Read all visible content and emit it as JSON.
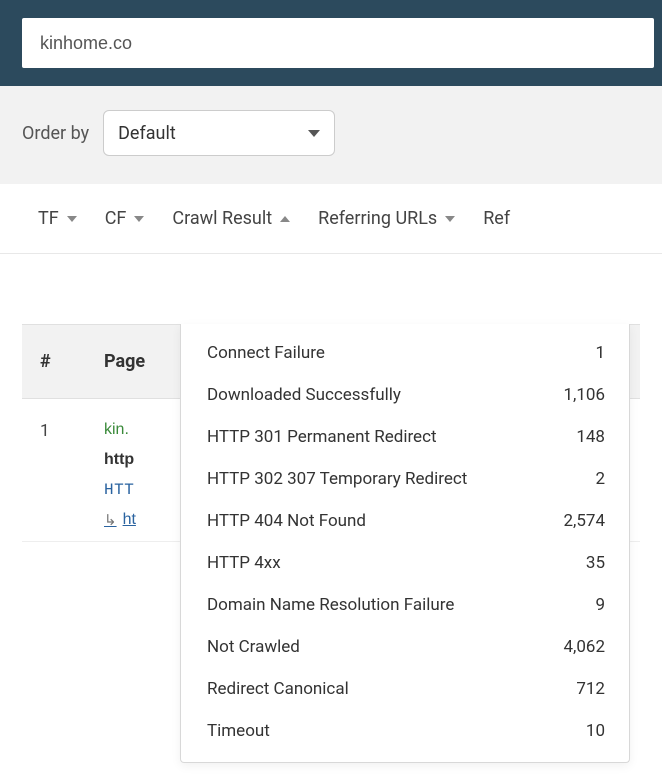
{
  "search": {
    "value": "kinhome.co"
  },
  "orderby": {
    "label": "Order by",
    "selected": "Default"
  },
  "filters": {
    "tf": "TF",
    "cf": "CF",
    "crawl": "Crawl Result",
    "referring": "Referring URLs",
    "ref_partial": "Ref"
  },
  "table": {
    "headers": {
      "hash": "#",
      "page": "Page"
    },
    "rows": [
      {
        "index": "1",
        "domain": "kin.",
        "http": "http",
        "httpmono": "HTT",
        "redirect": "ht"
      }
    ]
  },
  "crawl_dropdown": [
    {
      "label": "Connect Failure",
      "count": "1"
    },
    {
      "label": "Downloaded Successfully",
      "count": "1,106"
    },
    {
      "label": "HTTP 301 Permanent Redirect",
      "count": "148"
    },
    {
      "label": "HTTP 302 307 Temporary Redirect",
      "count": "2"
    },
    {
      "label": "HTTP 404 Not Found",
      "count": "2,574"
    },
    {
      "label": "HTTP 4xx",
      "count": "35"
    },
    {
      "label": "Domain Name Resolution Failure",
      "count": "9"
    },
    {
      "label": "Not Crawled",
      "count": "4,062"
    },
    {
      "label": "Redirect Canonical",
      "count": "712"
    },
    {
      "label": "Timeout",
      "count": "10"
    }
  ]
}
